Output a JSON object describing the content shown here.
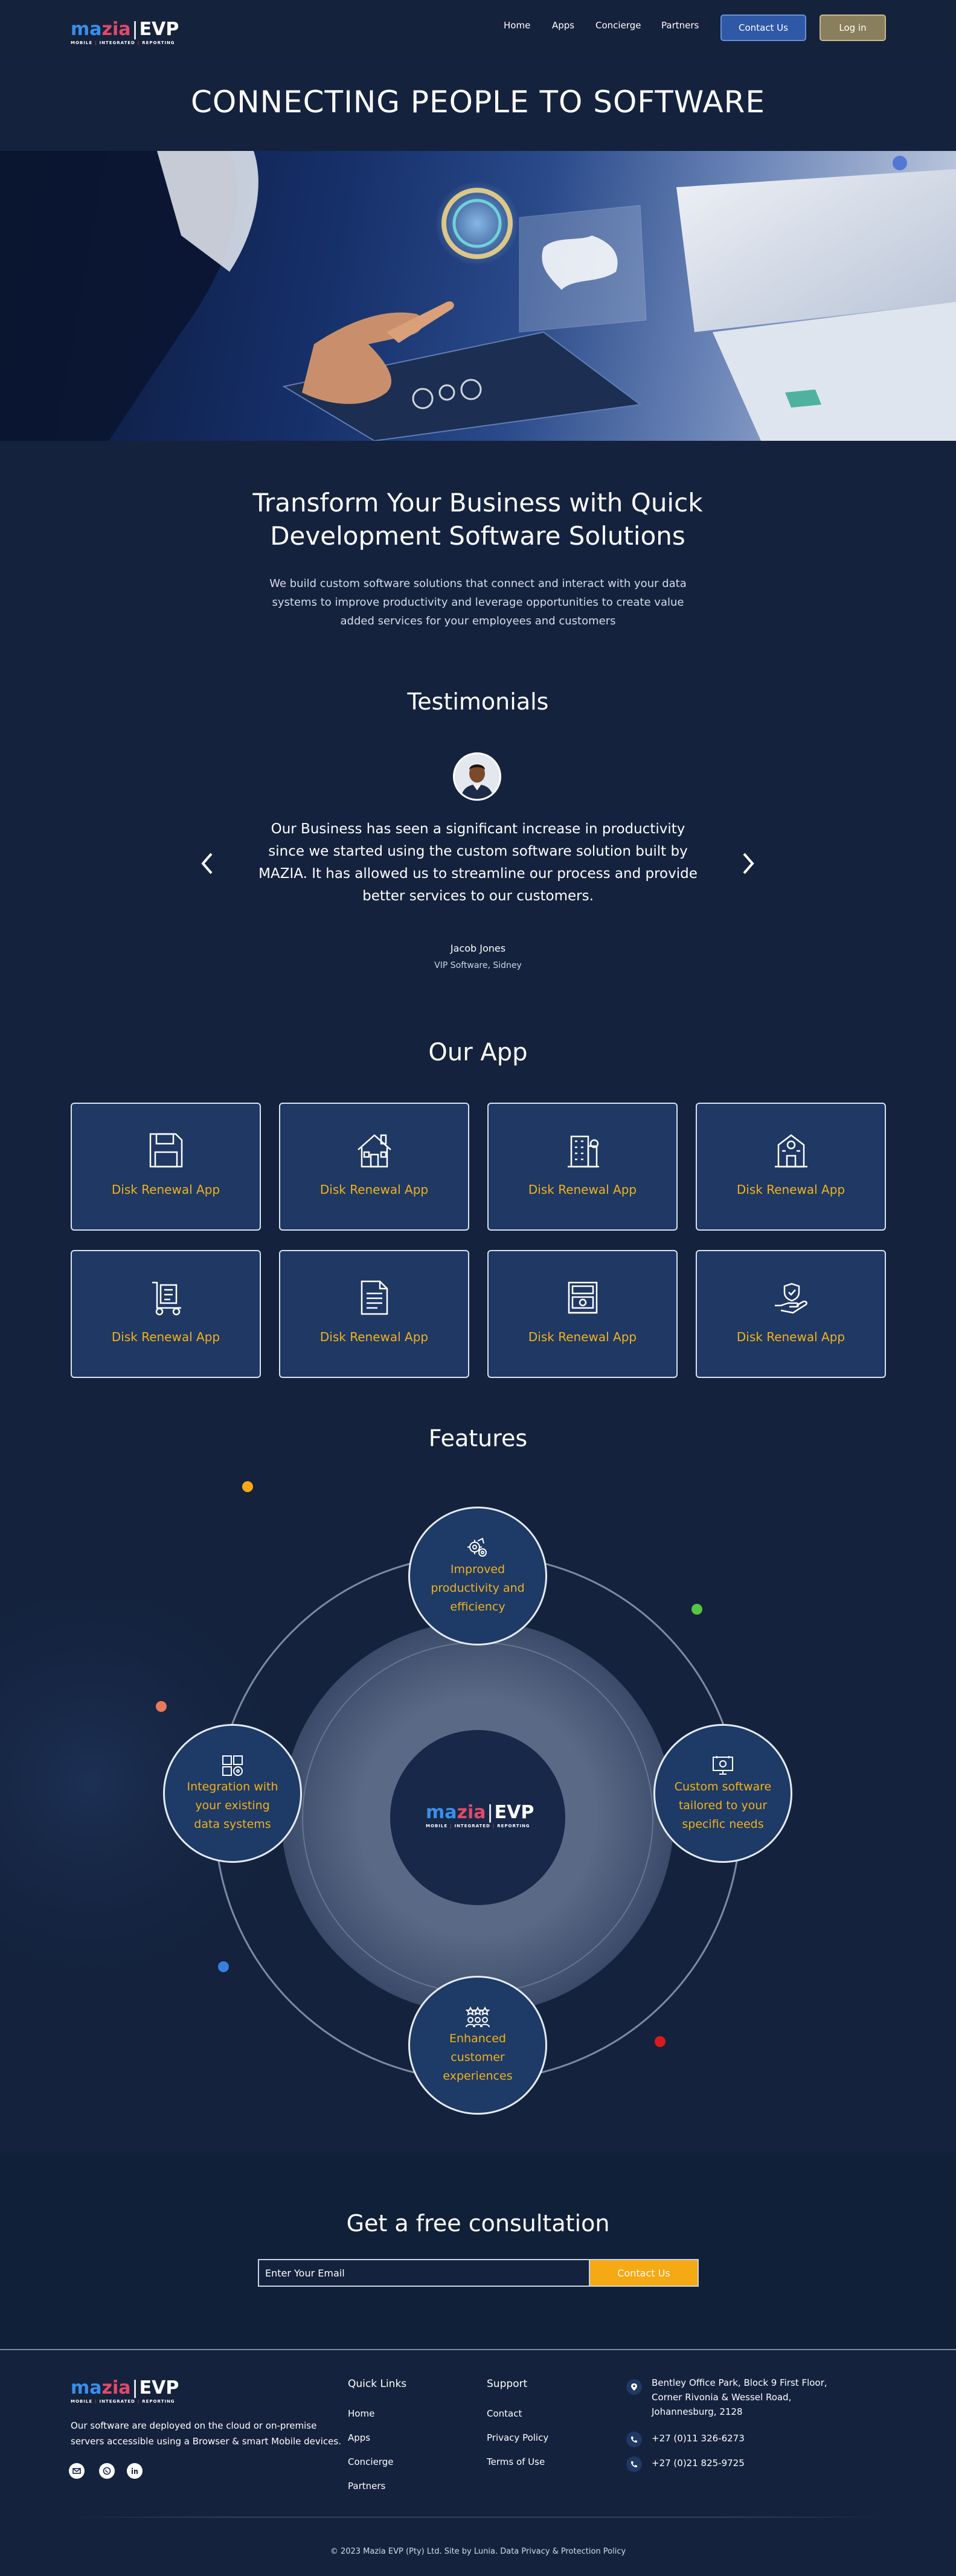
{
  "brand": {
    "mazia": "mazia",
    "evp": "EVP",
    "tag_mobile": "MOBILE",
    "tag_integrated": "INTEGRATED",
    "tag_reporting": "REPORTING"
  },
  "nav": {
    "links": [
      "Home",
      "Apps",
      "Concierge",
      "Partners"
    ],
    "contact_label": "Contact Us",
    "login_label": "Log in"
  },
  "hero": {
    "title": "CONNECTING PEOPLE TO SOFTWARE"
  },
  "intro": {
    "heading": "Transform Your Business with Quick Development Software Solutions",
    "text": "We build custom software solutions that connect and interact with your data systems to improve productivity and leverage opportunities to create value added services for your employees and customers"
  },
  "testimonials": {
    "title": "Testimonials",
    "quote": "Our Business has seen a significant increase in productivity since we started using the custom software solution built by MAZIA. It has allowed us to streamline our process and provide better services to our customers.",
    "name": "Jacob Jones",
    "role": "VIP Software, Sidney",
    "prev_icon": "chevron-left-icon",
    "next_icon": "chevron-right-icon"
  },
  "apps": {
    "title": "Our App",
    "items": [
      {
        "label": "Disk Renewal App",
        "icon": "floppy-disk-icon"
      },
      {
        "label": "Disk Renewal App",
        "icon": "house-icon"
      },
      {
        "label": "Disk Renewal App",
        "icon": "office-building-icon"
      },
      {
        "label": "Disk Renewal App",
        "icon": "school-building-icon"
      },
      {
        "label": "Disk Renewal App",
        "icon": "delivery-trolley-icon"
      },
      {
        "label": "Disk Renewal App",
        "icon": "document-icon"
      },
      {
        "label": "Disk Renewal App",
        "icon": "cash-register-icon"
      },
      {
        "label": "Disk Renewal App",
        "icon": "hand-shield-icon"
      }
    ]
  },
  "features": {
    "title": "Features",
    "items": [
      {
        "label": "Improved productivity and efficiency",
        "icon": "gears-icon"
      },
      {
        "label": "Integration with your existing data systems",
        "icon": "data-integration-icon"
      },
      {
        "label": "Custom software tailored to your specific needs",
        "icon": "monitor-icon"
      },
      {
        "label": "Enhanced customer experiences",
        "icon": "customers-stars-icon"
      }
    ],
    "dot_colors": [
      "#f5a913",
      "#57c443",
      "#e8795a",
      "#3a7fe0",
      "#d91b1b"
    ]
  },
  "consultation": {
    "title": "Get a free consultation",
    "email_placeholder": "Enter Your Email",
    "button_label": "Contact Us"
  },
  "footer": {
    "description": "Our software are deployed on the cloud or on-premise servers accessible using a Browser & smart Mobile devices.",
    "social": [
      "email-icon",
      "whatsapp-icon",
      "linkedin-icon"
    ],
    "quick_links_title": "Quick Links",
    "quick_links": [
      "Home",
      "Apps",
      "Concierge",
      "Partners"
    ],
    "support_title": "Support",
    "support_links": [
      "Contact",
      "Privacy Policy",
      "Terms of Use"
    ],
    "address": "Bentley Office Park, Block 9 First Floor, Corner Rivonia & Wessel Road, Johannesburg, 2128",
    "phone_1": "+27 (0)11 326-6273",
    "phone_2": "+27 (0)21 825-9725",
    "copyright": "© 2023 Mazia EVP (Pty) Ltd. Site by Lunia. Data Privacy & Protection Policy"
  },
  "colors": {
    "background": "#14223d",
    "accent_orange": "#f2b21b",
    "card_blue": "#1f3864",
    "button_blue": "#2f58a6"
  }
}
